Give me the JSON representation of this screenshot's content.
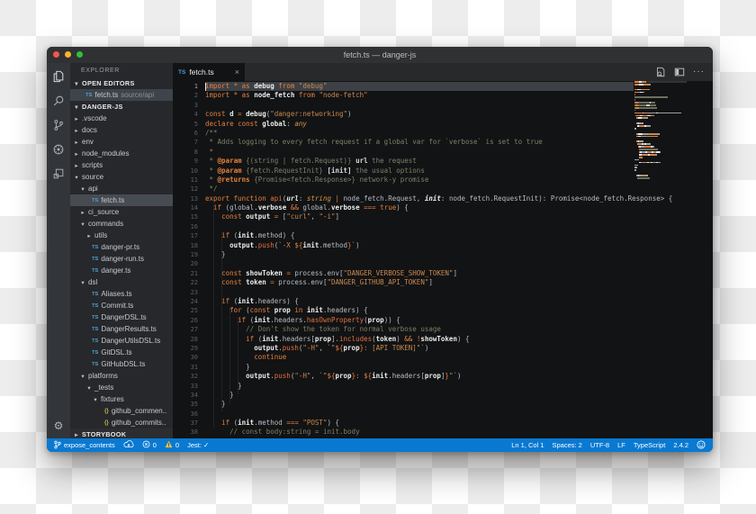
{
  "window": {
    "title": "fetch.ts — danger-js"
  },
  "activity_bar": {
    "items": [
      "explorer",
      "search",
      "source-control",
      "debug",
      "extensions"
    ],
    "bottom": [
      "settings"
    ]
  },
  "sidebar": {
    "title": "EXPLORER",
    "open_editors": {
      "header": "OPEN EDITORS",
      "items": [
        {
          "badge": "TS",
          "file": "fetch.ts",
          "path": "source/api"
        }
      ]
    },
    "project": {
      "header": "DANGER-JS",
      "tree": [
        {
          "label": ".vscode",
          "type": "folder",
          "state": "collapsed",
          "depth": 1
        },
        {
          "label": "docs",
          "type": "folder",
          "state": "collapsed",
          "depth": 1
        },
        {
          "label": "env",
          "type": "folder",
          "state": "collapsed",
          "depth": 1
        },
        {
          "label": "node_modules",
          "type": "folder",
          "state": "collapsed",
          "depth": 1
        },
        {
          "label": "scripts",
          "type": "folder",
          "state": "collapsed",
          "depth": 1
        },
        {
          "label": "source",
          "type": "folder",
          "state": "expanded",
          "depth": 1
        },
        {
          "label": "api",
          "type": "folder",
          "state": "expanded",
          "depth": 2
        },
        {
          "label": "fetch.ts",
          "type": "ts",
          "depth": 3,
          "selected": true
        },
        {
          "label": "ci_source",
          "type": "folder",
          "state": "collapsed",
          "depth": 2
        },
        {
          "label": "commands",
          "type": "folder",
          "state": "expanded",
          "depth": 2
        },
        {
          "label": "utils",
          "type": "folder",
          "state": "collapsed",
          "depth": 3
        },
        {
          "label": "danger-pr.ts",
          "type": "ts",
          "depth": 3
        },
        {
          "label": "danger-run.ts",
          "type": "ts",
          "depth": 3
        },
        {
          "label": "danger.ts",
          "type": "ts",
          "depth": 3
        },
        {
          "label": "dsl",
          "type": "folder",
          "state": "expanded",
          "depth": 2
        },
        {
          "label": "Aliases.ts",
          "type": "ts",
          "depth": 3
        },
        {
          "label": "Commit.ts",
          "type": "ts",
          "depth": 3
        },
        {
          "label": "DangerDSL.ts",
          "type": "ts",
          "depth": 3
        },
        {
          "label": "DangerResults.ts",
          "type": "ts",
          "depth": 3
        },
        {
          "label": "DangerUtilsDSL.ts",
          "type": "ts",
          "depth": 3
        },
        {
          "label": "GitDSL.ts",
          "type": "ts",
          "depth": 3
        },
        {
          "label": "GitHubDSL.ts",
          "type": "ts",
          "depth": 3
        },
        {
          "label": "platforms",
          "type": "folder",
          "state": "expanded",
          "depth": 2
        },
        {
          "label": "_tests",
          "type": "folder",
          "state": "expanded",
          "depth": 3
        },
        {
          "label": "fixtures",
          "type": "folder",
          "state": "expanded",
          "depth": 4
        },
        {
          "label": "github_commen..",
          "type": "json",
          "depth": 5
        },
        {
          "label": "github_commits..",
          "type": "json",
          "depth": 5
        }
      ]
    },
    "storybook": {
      "header": "STORYBOOK"
    }
  },
  "editor": {
    "tab": {
      "badge": "TS",
      "label": "fetch.ts",
      "close": "×"
    },
    "actions": [
      "open-preview",
      "split-editor",
      "more-actions"
    ],
    "lines": [
      {
        "n": 1,
        "hl": true,
        "t": [
          [
            "k",
            "import "
          ],
          [
            "o",
            "* "
          ],
          [
            "k",
            "as "
          ],
          [
            "i",
            "debug "
          ],
          [
            "k",
            "from "
          ],
          [
            "s",
            "\"debug\""
          ]
        ]
      },
      {
        "n": 2,
        "t": [
          [
            "k",
            "import "
          ],
          [
            "o",
            "* "
          ],
          [
            "k",
            "as "
          ],
          [
            "i",
            "node_fetch "
          ],
          [
            "k",
            "from "
          ],
          [
            "s",
            "\"node-fetch\""
          ]
        ]
      },
      {
        "n": 3,
        "t": []
      },
      {
        "n": 4,
        "t": [
          [
            "k",
            "const "
          ],
          [
            "i",
            "d "
          ],
          [
            "o",
            "= "
          ],
          [
            "i",
            "debug"
          ],
          [
            "p",
            "("
          ],
          [
            "s",
            "\"danger:networking\""
          ],
          [
            "p",
            ")"
          ]
        ]
      },
      {
        "n": 5,
        "t": [
          [
            "k",
            "declare "
          ],
          [
            "k",
            "const "
          ],
          [
            "i",
            "global"
          ],
          [
            "p",
            ": "
          ],
          [
            "t",
            "any"
          ]
        ]
      },
      {
        "n": 6,
        "t": [
          [
            "c",
            "/**"
          ]
        ]
      },
      {
        "n": 7,
        "t": [
          [
            "c",
            " * Adds logging to every fetch request if a global var for `verbose` is set to true"
          ]
        ]
      },
      {
        "n": 8,
        "t": [
          [
            "c",
            " *"
          ]
        ]
      },
      {
        "n": 9,
        "t": [
          [
            "c",
            " * "
          ],
          [
            "d",
            "@param "
          ],
          [
            "c",
            "{(string | fetch.Request)} "
          ],
          [
            "ci",
            "url "
          ],
          [
            "c",
            "the request"
          ]
        ]
      },
      {
        "n": 10,
        "t": [
          [
            "c",
            " * "
          ],
          [
            "d",
            "@param "
          ],
          [
            "c",
            "{fetch.RequestInit} "
          ],
          [
            "ci",
            "[init] "
          ],
          [
            "c",
            "the usual options"
          ]
        ]
      },
      {
        "n": 11,
        "t": [
          [
            "c",
            " * "
          ],
          [
            "d",
            "@returns "
          ],
          [
            "c",
            "{Promise<fetch.Response>} network-y promise"
          ]
        ]
      },
      {
        "n": 12,
        "t": [
          [
            "c",
            " */"
          ]
        ]
      },
      {
        "n": 13,
        "t": [
          [
            "k",
            "export "
          ],
          [
            "k",
            "function "
          ],
          [
            "f",
            "api"
          ],
          [
            "p",
            "("
          ],
          [
            "pi",
            "url"
          ],
          [
            "p",
            ": "
          ],
          [
            "t",
            "string "
          ],
          [
            "o",
            "| "
          ],
          [
            "p",
            "node_fetch.Request, "
          ],
          [
            "pi",
            "init"
          ],
          [
            "p",
            ": "
          ],
          [
            "p",
            "node_fetch.RequestInit): Promise<node_fetch.Response> {"
          ]
        ]
      },
      {
        "n": 14,
        "t": [
          [
            "p",
            "  "
          ],
          [
            "k",
            "if "
          ],
          [
            "p",
            "(global."
          ],
          [
            "i",
            "verbose "
          ],
          [
            "o",
            "&& "
          ],
          [
            "p",
            "global."
          ],
          [
            "i",
            "verbose "
          ],
          [
            "o",
            "=== "
          ],
          [
            "k",
            "true"
          ],
          [
            "p",
            ") {"
          ]
        ]
      },
      {
        "n": 15,
        "t": [
          [
            "p",
            "    "
          ],
          [
            "k",
            "const "
          ],
          [
            "i",
            "output "
          ],
          [
            "o",
            "= "
          ],
          [
            "p",
            "["
          ],
          [
            "s",
            "\"curl\""
          ],
          [
            "p",
            ", "
          ],
          [
            "s",
            "\"-i\""
          ],
          [
            "p",
            "]"
          ]
        ]
      },
      {
        "n": 16,
        "t": []
      },
      {
        "n": 17,
        "t": [
          [
            "p",
            "    "
          ],
          [
            "k",
            "if "
          ],
          [
            "p",
            "("
          ],
          [
            "i",
            "init"
          ],
          [
            "p",
            ".method) {"
          ]
        ]
      },
      {
        "n": 18,
        "t": [
          [
            "p",
            "      "
          ],
          [
            "i",
            "output"
          ],
          [
            "p",
            "."
          ],
          [
            "f",
            "push"
          ],
          [
            "p",
            "("
          ],
          [
            "s",
            "`-X "
          ],
          [
            "o",
            "${"
          ],
          [
            "i",
            "init"
          ],
          [
            "p",
            ".method"
          ],
          [
            "o",
            "}"
          ],
          [
            "s",
            "`"
          ],
          [
            "p",
            ")"
          ]
        ]
      },
      {
        "n": 19,
        "t": [
          [
            "p",
            "    }"
          ]
        ]
      },
      {
        "n": 20,
        "t": []
      },
      {
        "n": 21,
        "t": [
          [
            "p",
            "    "
          ],
          [
            "k",
            "const "
          ],
          [
            "i",
            "showToken "
          ],
          [
            "o",
            "= "
          ],
          [
            "p",
            "process.env["
          ],
          [
            "s",
            "\"DANGER_VERBOSE_SHOW_TOKEN\""
          ],
          [
            "p",
            "]"
          ]
        ]
      },
      {
        "n": 22,
        "t": [
          [
            "p",
            "    "
          ],
          [
            "k",
            "const "
          ],
          [
            "i",
            "token "
          ],
          [
            "o",
            "= "
          ],
          [
            "p",
            "process.env["
          ],
          [
            "s",
            "\"DANGER_GITHUB_API_TOKEN\""
          ],
          [
            "p",
            "]"
          ]
        ]
      },
      {
        "n": 23,
        "t": []
      },
      {
        "n": 24,
        "t": [
          [
            "p",
            "    "
          ],
          [
            "k",
            "if "
          ],
          [
            "p",
            "("
          ],
          [
            "i",
            "init"
          ],
          [
            "p",
            ".headers) {"
          ]
        ]
      },
      {
        "n": 25,
        "t": [
          [
            "p",
            "      "
          ],
          [
            "k",
            "for "
          ],
          [
            "p",
            "("
          ],
          [
            "k",
            "const "
          ],
          [
            "i",
            "prop "
          ],
          [
            "k",
            "in "
          ],
          [
            "i",
            "init"
          ],
          [
            "p",
            ".headers) {"
          ]
        ]
      },
      {
        "n": 26,
        "t": [
          [
            "p",
            "        "
          ],
          [
            "k",
            "if "
          ],
          [
            "p",
            "("
          ],
          [
            "i",
            "init"
          ],
          [
            "p",
            ".headers."
          ],
          [
            "f",
            "hasOwnProperty"
          ],
          [
            "p",
            "("
          ],
          [
            "i",
            "prop"
          ],
          [
            "p",
            ")) {"
          ]
        ]
      },
      {
        "n": 27,
        "t": [
          [
            "p",
            "          "
          ],
          [
            "c",
            "// Don't show the token for normal verbose usage"
          ]
        ]
      },
      {
        "n": 28,
        "t": [
          [
            "p",
            "          "
          ],
          [
            "k",
            "if "
          ],
          [
            "p",
            "("
          ],
          [
            "i",
            "init"
          ],
          [
            "p",
            ".headers["
          ],
          [
            "i",
            "prop"
          ],
          [
            "p",
            "]."
          ],
          [
            "f",
            "includes"
          ],
          [
            "p",
            "("
          ],
          [
            "i",
            "token"
          ],
          [
            "p",
            ") "
          ],
          [
            "o",
            "&& "
          ],
          [
            "o",
            "!"
          ],
          [
            "i",
            "showToken"
          ],
          [
            "p",
            ") {"
          ]
        ]
      },
      {
        "n": 29,
        "t": [
          [
            "p",
            "            "
          ],
          [
            "i",
            "output"
          ],
          [
            "p",
            "."
          ],
          [
            "f",
            "push"
          ],
          [
            "p",
            "("
          ],
          [
            "s",
            "\"-H\""
          ],
          [
            "p",
            ", "
          ],
          [
            "s",
            "`\""
          ],
          [
            "o",
            "${"
          ],
          [
            "i",
            "prop"
          ],
          [
            "o",
            "}"
          ],
          [
            "s",
            ": [API TOKEN]\"`"
          ],
          [
            "p",
            ")"
          ]
        ]
      },
      {
        "n": 30,
        "t": [
          [
            "p",
            "            "
          ],
          [
            "k",
            "continue"
          ]
        ]
      },
      {
        "n": 31,
        "t": [
          [
            "p",
            "          }"
          ]
        ]
      },
      {
        "n": 32,
        "t": [
          [
            "p",
            "          "
          ],
          [
            "i",
            "output"
          ],
          [
            "p",
            "."
          ],
          [
            "f",
            "push"
          ],
          [
            "p",
            "("
          ],
          [
            "s",
            "\"-H\""
          ],
          [
            "p",
            ", "
          ],
          [
            "s",
            "`\""
          ],
          [
            "o",
            "${"
          ],
          [
            "i",
            "prop"
          ],
          [
            "o",
            "}"
          ],
          [
            "s",
            ": "
          ],
          [
            "o",
            "${"
          ],
          [
            "i",
            "init"
          ],
          [
            "p",
            ".headers["
          ],
          [
            "i",
            "prop"
          ],
          [
            "p",
            "]"
          ],
          [
            "o",
            "}"
          ],
          [
            "s",
            "\"`"
          ],
          [
            "p",
            ")"
          ]
        ]
      },
      {
        "n": 33,
        "t": [
          [
            "p",
            "        }"
          ]
        ]
      },
      {
        "n": 34,
        "t": [
          [
            "p",
            "      }"
          ]
        ]
      },
      {
        "n": 35,
        "t": [
          [
            "p",
            "    }"
          ]
        ]
      },
      {
        "n": 36,
        "t": []
      },
      {
        "n": 37,
        "t": [
          [
            "p",
            "    "
          ],
          [
            "k",
            "if "
          ],
          [
            "p",
            "("
          ],
          [
            "i",
            "init"
          ],
          [
            "p",
            ".method "
          ],
          [
            "o",
            "=== "
          ],
          [
            "s",
            "\"POST\""
          ],
          [
            "p",
            ") {"
          ]
        ]
      },
      {
        "n": 38,
        "t": [
          [
            "p",
            "      "
          ],
          [
            "c",
            "// const body:string = init.body"
          ]
        ]
      }
    ]
  },
  "status_bar": {
    "left": [
      {
        "icon": "git-branch",
        "label": "expose_contents"
      },
      {
        "icon": "cloud-upload",
        "label": ""
      },
      {
        "icon": "error",
        "label": "0"
      },
      {
        "icon": "warning",
        "label": "0"
      },
      {
        "icon": "",
        "label": "Jest: ✓"
      }
    ],
    "right": [
      {
        "icon": "",
        "label": "Ln 1, Col 1"
      },
      {
        "icon": "",
        "label": "Spaces: 2"
      },
      {
        "icon": "",
        "label": "UTF-8"
      },
      {
        "icon": "",
        "label": "LF"
      },
      {
        "icon": "",
        "label": "TypeScript"
      },
      {
        "icon": "",
        "label": "2.4.2"
      },
      {
        "icon": "smiley",
        "label": ""
      }
    ]
  },
  "colors": {
    "status_bar": "#0a79d1",
    "editor_bg": "#121314",
    "sidebar_bg": "#26282c",
    "keyword": "#e4813d",
    "string": "#c98a4f",
    "ts_badge": "#4f9fcf",
    "json_badge": "#c9b648"
  }
}
